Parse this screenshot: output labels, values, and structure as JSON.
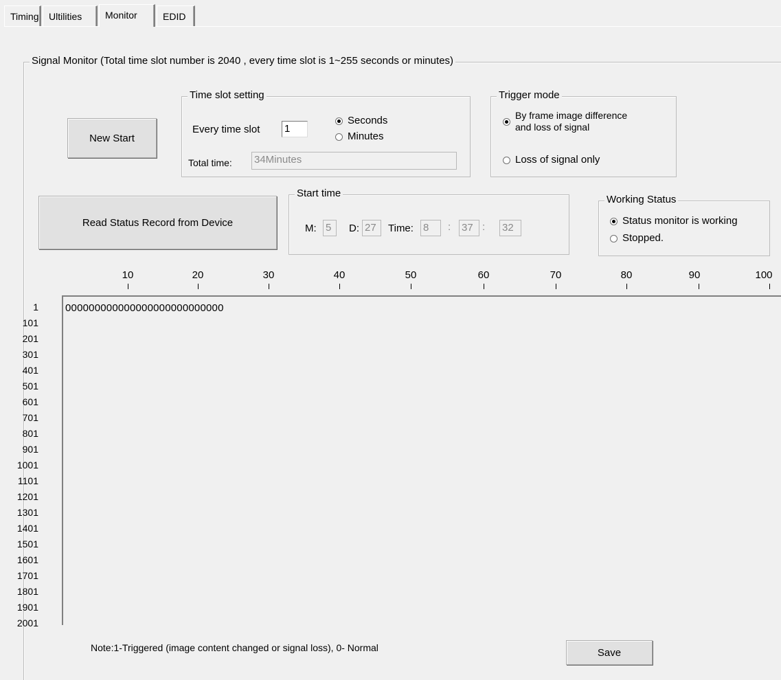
{
  "tabs": [
    "Timing",
    "Ultilities",
    "Monitor",
    "EDID"
  ],
  "signal_monitor": {
    "title": "Signal Monitor (Total time slot number is 2040 , every time slot is 1~255 seconds or minutes)"
  },
  "new_start_label": "New Start",
  "time_slot": {
    "title": "Time slot setting",
    "every_label": "Every time slot",
    "every_value": "1",
    "seconds_label": "Seconds",
    "minutes_label": "Minutes",
    "selected": "Seconds",
    "total_label": "Total time:",
    "total_value": "34Minutes"
  },
  "trigger": {
    "title": "Trigger mode",
    "option1": "By frame image difference\nand loss of signal",
    "option2": "Loss of signal only",
    "selected": "option1"
  },
  "read_button_label": "Read Status Record from Device",
  "start_time": {
    "title": "Start time",
    "m_label": "M:",
    "m_value": "5",
    "d_label": "D:",
    "d_value": "27",
    "time_label": "Time:",
    "hour": "8",
    "sep1": ":",
    "minute": "37",
    "sep2": ":",
    "second": "32"
  },
  "working_status": {
    "title": "Working Status",
    "working_label": "Status monitor is working",
    "stopped_label": "Stopped.",
    "selected": "working"
  },
  "ruler": [
    "10",
    "20",
    "30",
    "40",
    "50",
    "60",
    "70",
    "80",
    "90",
    "100"
  ],
  "row_labels": [
    "1",
    "101",
    "201",
    "301",
    "401",
    "501",
    "601",
    "701",
    "801",
    "901",
    "1001",
    "1101",
    "1201",
    "1301",
    "1401",
    "1501",
    "1601",
    "1701",
    "1801",
    "1901",
    "2001"
  ],
  "monitor_data": "000000000000000000000000000",
  "note": "Note:1-Triggered (image content changed or signal loss), 0- Normal",
  "save_label": "Save"
}
